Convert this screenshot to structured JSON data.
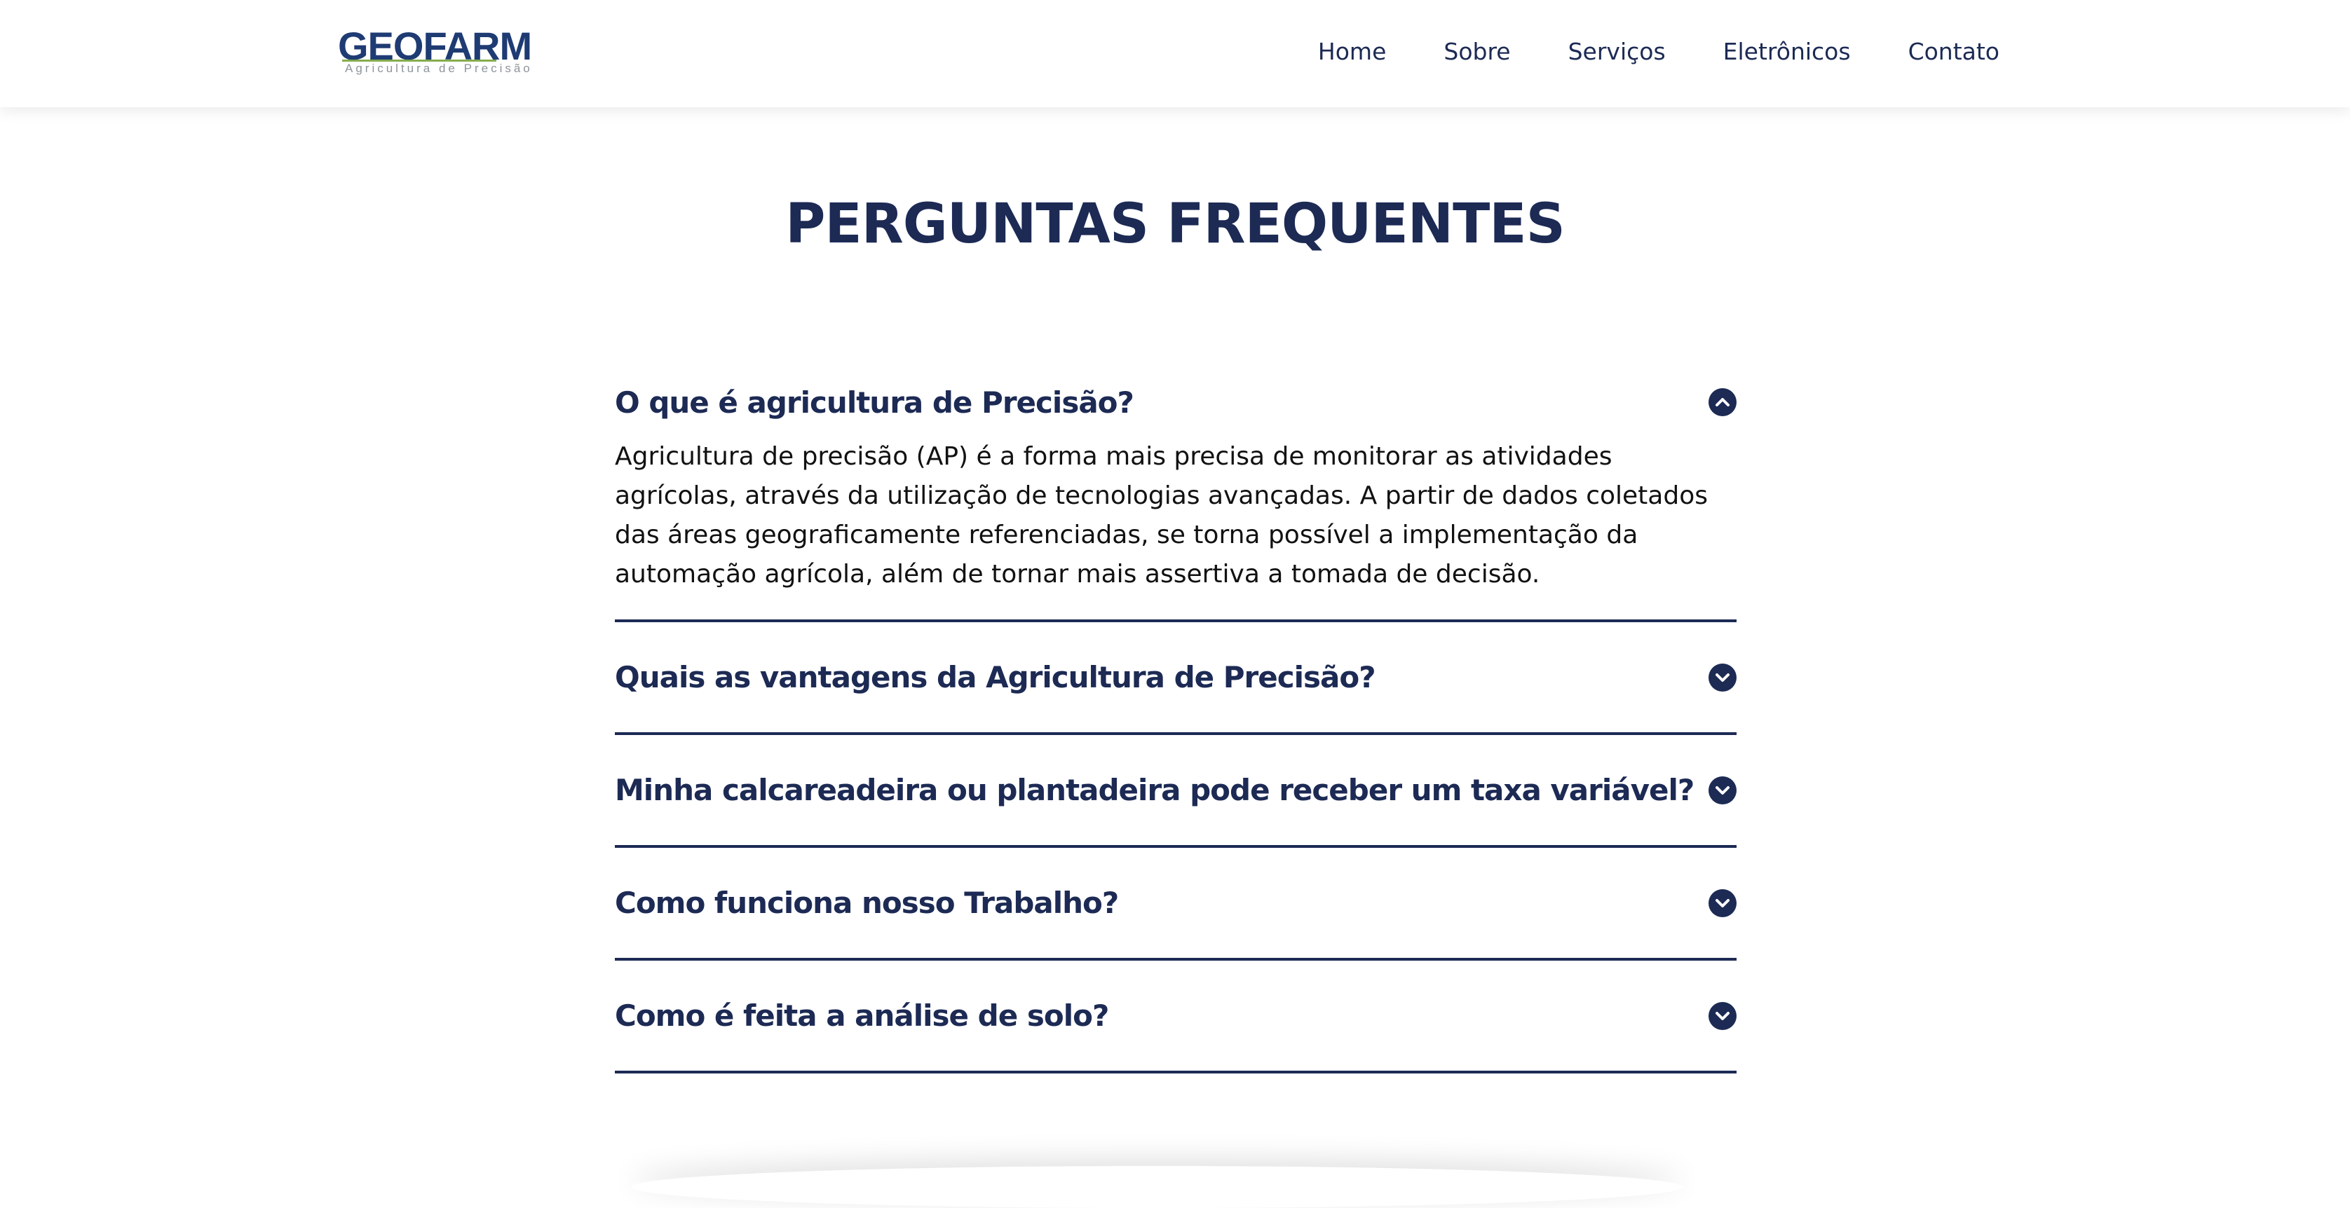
{
  "header": {
    "logo": {
      "word": "GEOFARM",
      "tagline": "Agricultura de Precisão"
    },
    "nav": [
      {
        "label": "Home"
      },
      {
        "label": "Sobre"
      },
      {
        "label": "Serviços"
      },
      {
        "label": "Eletrônicos"
      },
      {
        "label": "Contato"
      }
    ]
  },
  "main": {
    "title": "PERGUNTAS FREQUENTES",
    "faq": [
      {
        "question": "O que é agricultura de Precisão?",
        "expanded": true,
        "answer": "Agricultura de precisão (AP) é a forma mais precisa de monitorar as atividades agrícolas, através da utilização de tecnologias avançadas. A partir de dados coletados das áreas geograficamente referenciadas, se torna possível a implementação da automação agrícola, além de tornar mais assertiva a tomada de decisão."
      },
      {
        "question": "Quais as vantagens da Agricultura de Precisão?",
        "expanded": false
      },
      {
        "question": "Minha calcareadeira ou plantadeira pode receber um taxa variável?",
        "expanded": false
      },
      {
        "question": "Como funciona nosso Trabalho?",
        "expanded": false
      },
      {
        "question": "Como é feita a análise de solo?",
        "expanded": false
      }
    ]
  },
  "colors": {
    "primary": "#1c2a54",
    "logo_blue": "#1f3b73",
    "logo_green": "#6f9f2f",
    "text": "#111111",
    "background": "#ffffff"
  },
  "icons": {
    "expanded": "chevron-up-icon",
    "collapsed": "chevron-down-icon"
  }
}
